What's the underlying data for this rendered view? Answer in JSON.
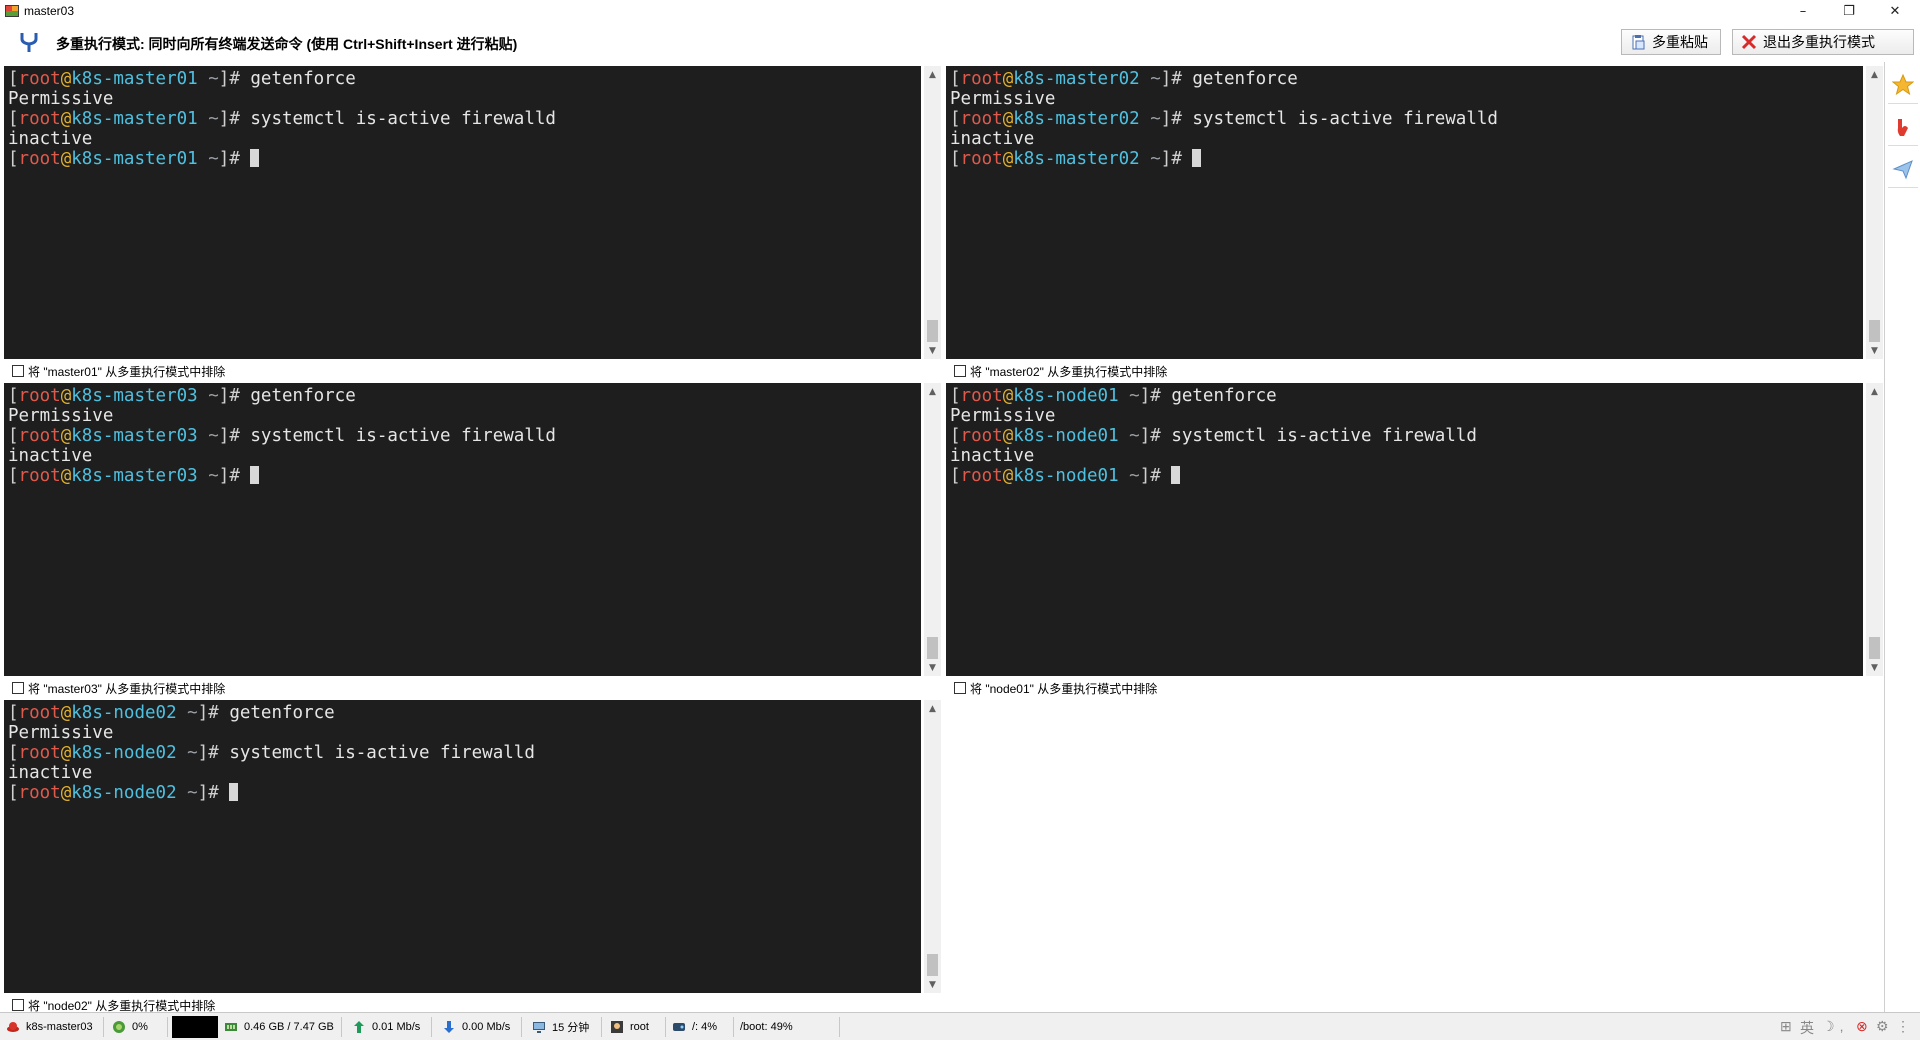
{
  "window": {
    "title": "master03",
    "minimize": "–",
    "restore": "❐",
    "close": "✕"
  },
  "toolbar": {
    "mode_text": "多重执行模式: 同时向所有终端发送命令 (使用 Ctrl+Shift+Insert 进行粘贴)",
    "multi_paste": "多重粘贴",
    "exit_multi": "退出多重执行模式"
  },
  "panes": [
    {
      "host": "k8s-master01",
      "exclude": "将 \"master01\" 从多重执行模式中排除"
    },
    {
      "host": "k8s-master02",
      "exclude": "将 \"master02\" 从多重执行模式中排除"
    },
    {
      "host": "k8s-master03",
      "exclude": "将 \"master03\" 从多重执行模式中排除"
    },
    {
      "host": "k8s-node01",
      "exclude": "将 \"node01\" 从多重执行模式中排除"
    },
    {
      "host": "k8s-node02",
      "exclude": "将 \"node02\" 从多重执行模式中排除"
    }
  ],
  "terminal": {
    "user": "root",
    "cmd1": "getenforce",
    "out1": "Permissive",
    "cmd2": "systemctl is-active firewalld",
    "out2": "inactive"
  },
  "statusbar": {
    "host": "k8s-master03",
    "cpu": "0%",
    "mem": "0.46 GB / 7.47 GB",
    "upload": "0.01 Mb/s",
    "download": "0.00 Mb/s",
    "uptime": "15 分钟",
    "user": "root",
    "disk_root": "/: 4%",
    "disk_boot": "/boot: 49%"
  },
  "icons": {
    "fork": "fork-icon",
    "star": "star-icon",
    "sidebar_app": "app-icon",
    "send": "send-icon"
  },
  "colors": {
    "terminal_bg": "#1e1e1e",
    "user": "#e05a4c",
    "host": "#4ec0e0",
    "at": "#e0b030"
  }
}
